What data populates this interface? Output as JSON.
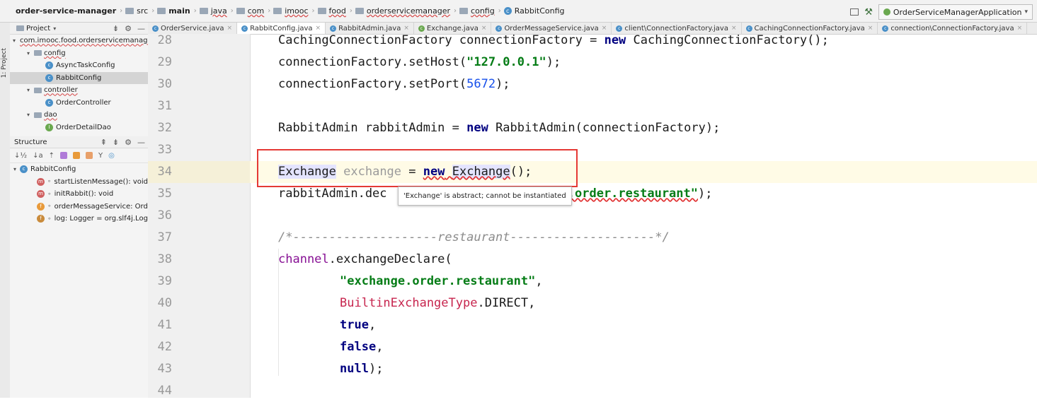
{
  "navbar": {
    "breadcrumbs": [
      {
        "label": "order-service-manager",
        "kind": "project"
      },
      {
        "label": "src",
        "kind": "folder"
      },
      {
        "label": "main",
        "kind": "folder"
      },
      {
        "label": "java",
        "kind": "folder"
      },
      {
        "label": "com",
        "kind": "folder"
      },
      {
        "label": "imooc",
        "kind": "folder"
      },
      {
        "label": "food",
        "kind": "folder"
      },
      {
        "label": "orderservicemanager",
        "kind": "folder"
      },
      {
        "label": "config",
        "kind": "folder"
      },
      {
        "label": "RabbitConfig",
        "kind": "class"
      }
    ],
    "run_config": "OrderServiceManagerApplication"
  },
  "tool_strip": {
    "project_label": "1: Project"
  },
  "project_panel": {
    "title": "Project",
    "tree": [
      {
        "label": "com.imooc.food.orderservicemanager",
        "depth": 0,
        "type": "package",
        "expanded": true
      },
      {
        "label": "config",
        "depth": 1,
        "type": "folder",
        "expanded": true
      },
      {
        "label": "AsyncTaskConfig",
        "depth": 2,
        "type": "class"
      },
      {
        "label": "RabbitConfig",
        "depth": 2,
        "type": "class",
        "selected": true
      },
      {
        "label": "controller",
        "depth": 1,
        "type": "folder",
        "expanded": true
      },
      {
        "label": "OrderController",
        "depth": 2,
        "type": "class"
      },
      {
        "label": "dao",
        "depth": 1,
        "type": "folder",
        "expanded": true
      },
      {
        "label": "OrderDetailDao",
        "depth": 2,
        "type": "interface"
      }
    ]
  },
  "structure_panel": {
    "title": "Structure",
    "root": "RabbitConfig",
    "members": [
      {
        "label": "startListenMessage(): void",
        "kind": "m"
      },
      {
        "label": "initRabbit(): void",
        "kind": "m"
      },
      {
        "label": "orderMessageService: Ord",
        "kind": "f"
      },
      {
        "label": "log: Logger = org.slf4j.Log",
        "kind": "s"
      }
    ]
  },
  "tabs": [
    {
      "label": "OrderService.java",
      "active": false
    },
    {
      "label": "RabbitConfig.java",
      "active": true
    },
    {
      "label": "RabbitAdmin.java",
      "active": false
    },
    {
      "label": "Exchange.java",
      "active": false
    },
    {
      "label": "OrderMessageService.java",
      "active": false
    },
    {
      "label": "client\\ConnectionFactory.java",
      "active": false
    },
    {
      "label": "CachingConnectionFactory.java",
      "active": false
    },
    {
      "label": "connection\\ConnectionFactory.java",
      "active": false
    }
  ],
  "editor": {
    "line_numbers": [
      "28",
      "29",
      "30",
      "31",
      "32",
      "33",
      "34",
      "35",
      "36",
      "37",
      "38",
      "39",
      "40",
      "41",
      "42",
      "43",
      "44"
    ],
    "current_line": "34",
    "tooltip": "'Exchange' is abstract; cannot be instantiated",
    "code": {
      "l28a": "CachingConnectionFactory connectionFactory = ",
      "l28kw": "new",
      "l28b": " CachingConnectionFactory();",
      "l29a": "connectionFactory.setHost(",
      "l29s": "\"127.0.0.1\"",
      "l29b": ");",
      "l30a": "connectionFactory.setPort(",
      "l30n": "5672",
      "l30b": ");",
      "l32a": "RabbitAdmin rabbitAdmin = ",
      "l32kw": "new",
      "l32b": " RabbitAdmin(connectionFactory);",
      "l34t": "Exchange",
      "l34v": "exchange",
      "l34eq": " = ",
      "l34kw": "new",
      "l34sp": " ",
      "l34c": "Exchange",
      "l34e": "();",
      "l35a": "rabbitAdmin.dec",
      "l35s": "e.order.restaurant\"",
      "l35b": ");",
      "l37c": "/*--------------------restaurant--------------------*/",
      "l38f": "channel",
      "l38a": ".exchangeDeclare(",
      "l39s": "\"exchange.order.restaurant\"",
      "l39b": ",",
      "l40sf": "BuiltinExchangeType",
      "l40b": ".DIRECT,",
      "l41kw": "true",
      "l41b": ",",
      "l42kw": "false",
      "l42b": ",",
      "l43kw": "null",
      "l43b": ");"
    }
  }
}
